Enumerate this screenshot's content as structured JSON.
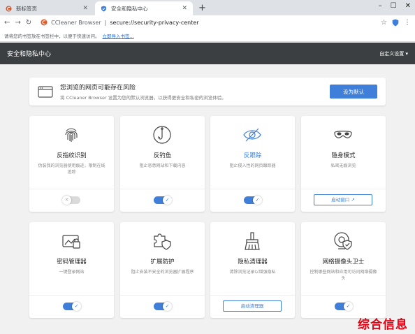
{
  "tabs": [
    {
      "title": "新标签页",
      "icon": "ccleaner-icon"
    },
    {
      "title": "安全和隐私中心",
      "icon": "shield-icon"
    }
  ],
  "address": {
    "site": "CCleaner Browser",
    "separator": "|",
    "url": "secure://security-privacy-center"
  },
  "bookmark_bar": {
    "prompt": "请将您的书签放在书签栏中，以便于快速访问。",
    "import_link": "立即导入书签..."
  },
  "header": {
    "title": "安全和隐私中心",
    "menu": "自定义设置 ▾"
  },
  "banner": {
    "title": "您浏览的网页可能存在风险",
    "subtitle": "将 CCleaner Browser 设置为您的默认浏览器，以获得更安全和私密的浏览体验。",
    "button": "设为默认"
  },
  "cards": [
    {
      "title": "反指纹识别",
      "desc": "伪装我的浏览器使用痕迹，限制在线追踪",
      "control": "toggle",
      "state": "off",
      "icon": "fingerprint-icon"
    },
    {
      "title": "反钓鱼",
      "desc": "阻止恶意网站和下载内容",
      "control": "toggle",
      "state": "on",
      "icon": "fishhook-icon"
    },
    {
      "title": "反跟踪",
      "desc": "阻止侵入性的网页跟踪器",
      "control": "toggle",
      "state": "on",
      "icon": "eye-slash-icon"
    },
    {
      "title": "隐身模式",
      "desc": "私密无痕浏览",
      "control": "button",
      "button_label": "启动窗口",
      "icon": "mask-icon"
    },
    {
      "title": "密码管理器",
      "desc": "一键登录网站",
      "control": "toggle",
      "state": "on",
      "icon": "password-lock-icon"
    },
    {
      "title": "扩展防护",
      "desc": "阻止安装不安全的浏览器扩展程序",
      "control": "toggle",
      "state": "on",
      "icon": "puzzle-shield-icon"
    },
    {
      "title": "隐私清理器",
      "desc": "清除浏览记录以增强隐私",
      "control": "button",
      "button_label": "启动清理器",
      "icon": "broom-icon"
    },
    {
      "title": "网络摄像头卫士",
      "desc": "控制哪些网站和应用可访问网络摄像头",
      "control": "toggle",
      "state": "on",
      "icon": "webcam-shield-icon"
    }
  ],
  "watermark": "综合信息",
  "colors": {
    "accent": "#3f7fd9",
    "header_bg": "#3c3f42",
    "watermark": "#e60012"
  }
}
